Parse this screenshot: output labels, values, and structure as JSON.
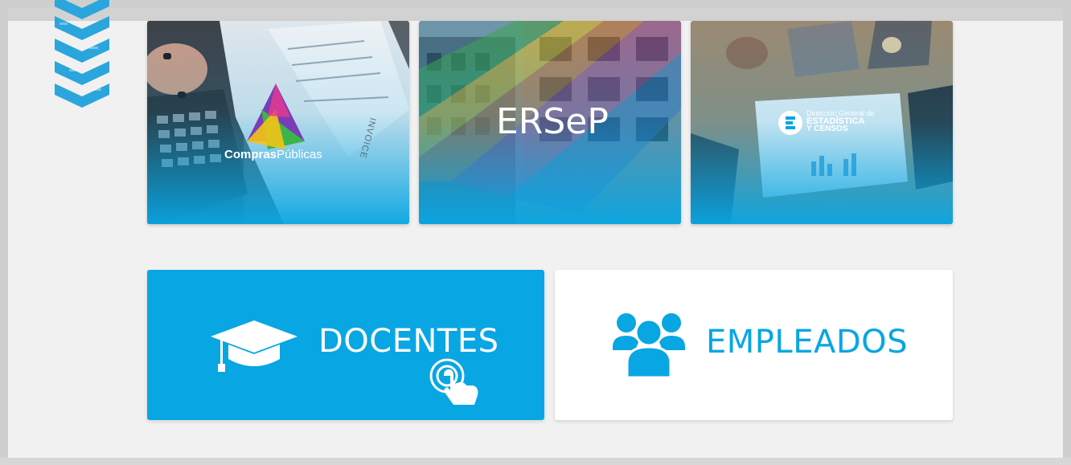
{
  "cards": [
    {
      "name": "compras-publicas",
      "brand_bold": "Compras",
      "brand_light": "Públicas",
      "paper_text": "INVOICE"
    },
    {
      "name": "ersep",
      "brand": "ERSeP"
    },
    {
      "name": "estadistica-censos",
      "line1": "Dirección General de",
      "line2": "ESTADÍSTICA",
      "line3": "Y CENSOS"
    }
  ],
  "buttons": {
    "docentes": "DOCENTES",
    "empleados": "EMPLEADOS"
  },
  "colors": {
    "accent": "#08a6e3",
    "background": "#f1f1f1",
    "card_white": "#ffffff"
  },
  "icons": {
    "docentes": "graduation-cap-icon",
    "touch": "touch-hand-icon",
    "empleados": "user-group-icon",
    "decor": "chevron-stack-icon"
  }
}
